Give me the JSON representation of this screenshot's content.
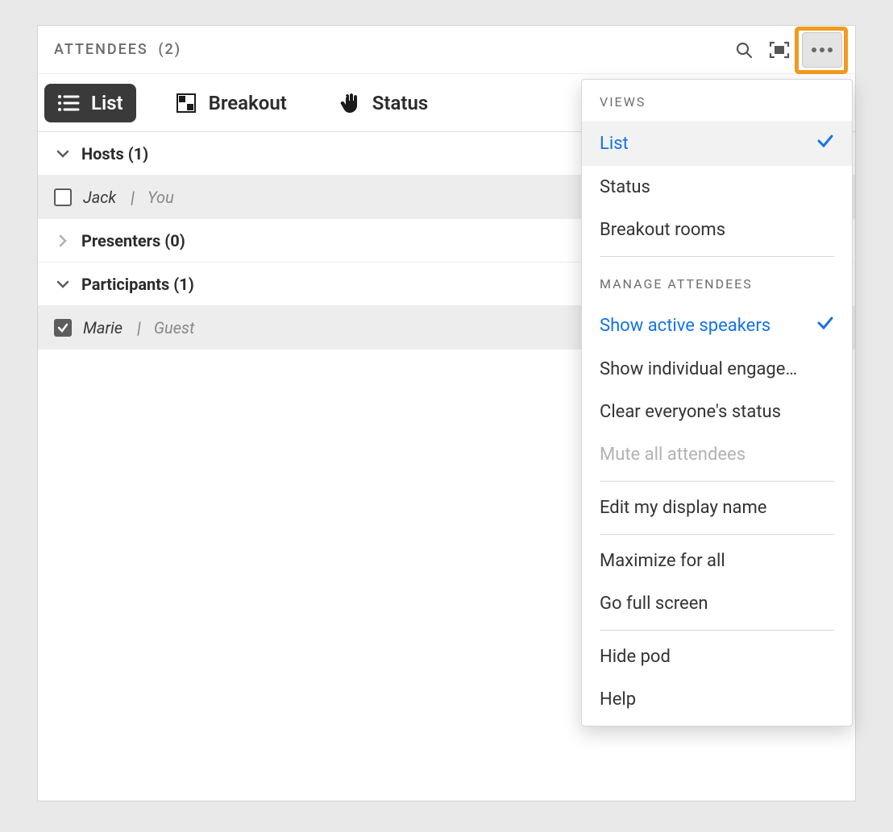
{
  "header": {
    "title": "ATTENDEES",
    "count": "(2)"
  },
  "tabs": {
    "list": "List",
    "breakout": "Breakout",
    "status": "Status"
  },
  "groups": {
    "hosts_label": "Hosts (1)",
    "presenters_label": "Presenters (0)",
    "participants_label": "Participants (1)"
  },
  "rows": {
    "jack_name": "Jack",
    "jack_sep": "|",
    "jack_suffix": "You",
    "marie_name": "Marie",
    "marie_sep": "|",
    "marie_suffix": "Guest"
  },
  "menu": {
    "views_title": "VIEWS",
    "views": {
      "list": "List",
      "status": "Status",
      "breakout": "Breakout rooms"
    },
    "manage_title": "MANAGE ATTENDEES",
    "manage": {
      "active_speakers": "Show active speakers",
      "individual_engage": "Show individual engage…",
      "clear_status": "Clear everyone's status",
      "mute_all": "Mute all attendees"
    },
    "edit_name": "Edit my display name",
    "maximize": "Maximize for all",
    "fullscreen": "Go full screen",
    "hide_pod": "Hide pod",
    "help": "Help"
  }
}
